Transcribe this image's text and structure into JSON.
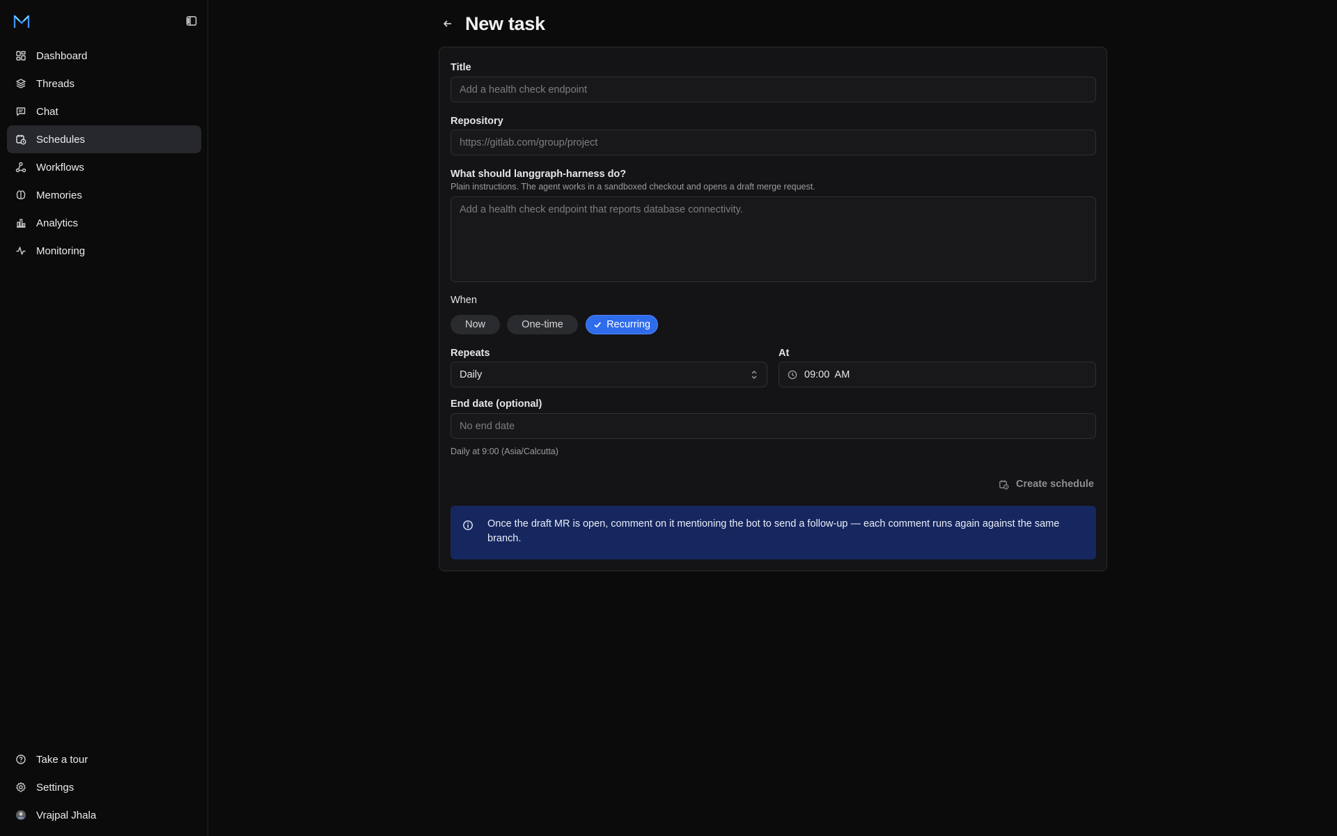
{
  "sidebar": {
    "logo": "brand-logo",
    "collapse_icon": "sidebar-collapse-icon",
    "items": [
      {
        "label": "Dashboard",
        "icon": "dashboard-icon"
      },
      {
        "label": "Threads",
        "icon": "layers-icon"
      },
      {
        "label": "Chat",
        "icon": "chat-icon"
      },
      {
        "label": "Schedules",
        "icon": "calendar-clock-icon",
        "active": true
      },
      {
        "label": "Workflows",
        "icon": "workflow-icon"
      },
      {
        "label": "Memories",
        "icon": "brain-icon"
      },
      {
        "label": "Analytics",
        "icon": "bar-chart-icon"
      },
      {
        "label": "Monitoring",
        "icon": "activity-icon"
      }
    ],
    "bottom": [
      {
        "label": "Take a tour",
        "icon": "help-circle-icon"
      },
      {
        "label": "Settings",
        "icon": "gear-icon"
      },
      {
        "label": "Vrajpal Jhala",
        "icon": "avatar"
      }
    ]
  },
  "header": {
    "title": "New task",
    "back_icon": "arrow-left-icon"
  },
  "form": {
    "title_label": "Title",
    "title_placeholder": "Add a health check endpoint",
    "title_value": "",
    "repo_label": "Repository",
    "repo_placeholder": "https://gitlab.com/group/project",
    "repo_value": "",
    "instructions_label": "What should langgraph-harness do?",
    "instructions_help": "Plain instructions. The agent works in a sandboxed checkout and opens a draft merge request.",
    "instructions_placeholder": "Add a health check endpoint that reports database connectivity.",
    "when_label": "When",
    "when_options": [
      "Now",
      "One-time",
      "Recurring"
    ],
    "when_selected": "Recurring",
    "repeats_label": "Repeats",
    "repeats_value": "Daily",
    "at_label": "At",
    "at_value": "09:00  AM",
    "end_date_label": "End date (optional)",
    "end_date_placeholder": "No end date",
    "summary": "Daily at 9:00 (Asia/Calcutta)",
    "create_label": "Create schedule"
  },
  "info": {
    "text": "Once the draft MR is open, comment on it mentioning the bot to send a follow-up — each comment runs again against the same branch."
  },
  "colors": {
    "accent": "#2f6cec",
    "info_bg": "#16275f",
    "logo_blue": "#3b8ff0"
  }
}
